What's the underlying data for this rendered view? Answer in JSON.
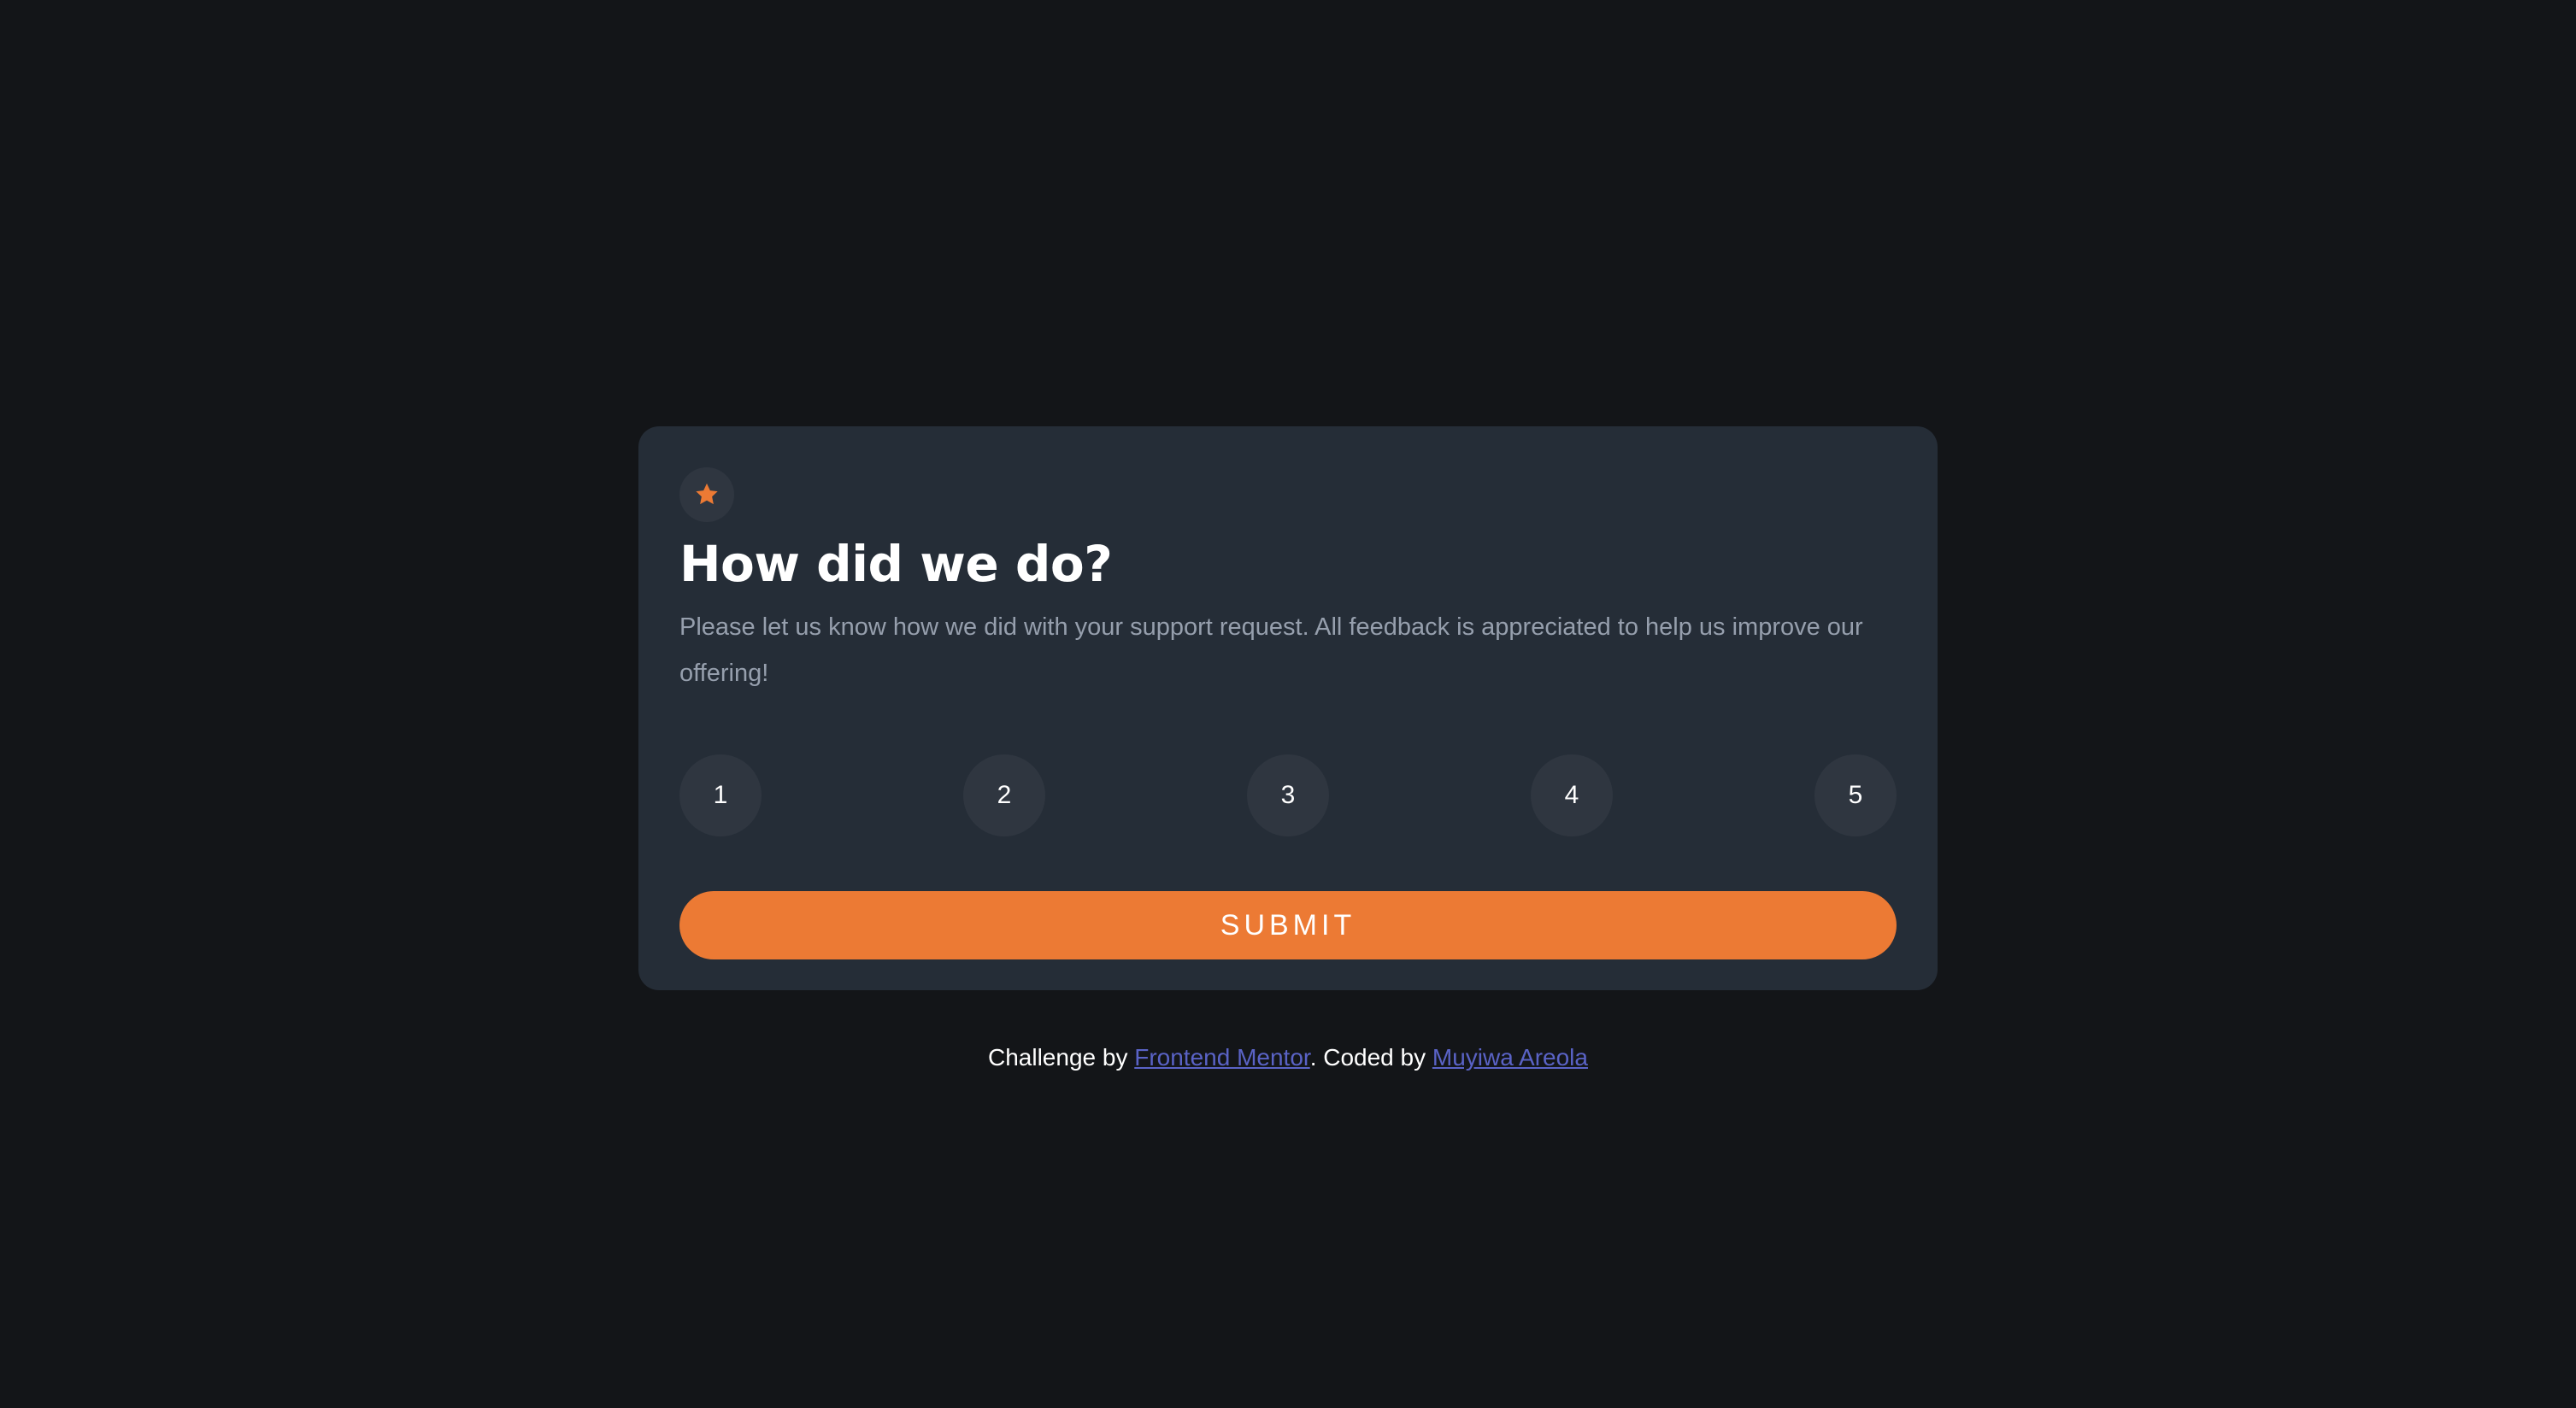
{
  "card": {
    "icon": "star-icon",
    "title": "How did we do?",
    "description": "Please let us know how we did with your support request. All feedback is appreciated to help us improve our offering!",
    "ratings": [
      "1",
      "2",
      "3",
      "4",
      "5"
    ],
    "submit_label": "SUBMIT"
  },
  "footer": {
    "prefix": "Challenge by ",
    "link1": "Frontend Mentor",
    "middle": ". Coded by ",
    "link2": "Muyiwa Areola"
  },
  "colors": {
    "background": "#131518",
    "card": "#252d37",
    "accent": "#ec7a34",
    "muted_text": "#969fad",
    "link": "#5a63c6"
  }
}
